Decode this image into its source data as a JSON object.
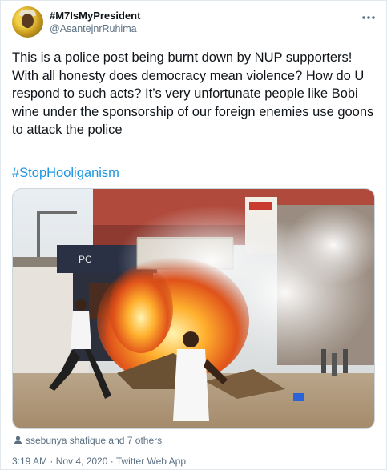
{
  "tweet": {
    "display_name": "#M7IsMyPresident",
    "handle": "@AsantejnrRuhima",
    "more_icon": "more-horizontal-icon",
    "text": "This is a police post being burnt down by NUP supporters! With all honesty does democracy mean violence? How do U respond to such acts? It’s very unfortunate people like Bobi wine under the sponsorship of our foreign enemies use goons to attack the police",
    "hashtag": "#StopHooliganism",
    "media_sign": "PC",
    "liked_by": "ssebunya shafique and 7 others",
    "timestamp": "3:19 AM · Nov 4, 2020 · Twitter Web App"
  },
  "colors": {
    "link": "#1b95e0",
    "secondary_text": "#5b7083",
    "primary_text": "#0f1419",
    "border": "#e1e8ed"
  }
}
